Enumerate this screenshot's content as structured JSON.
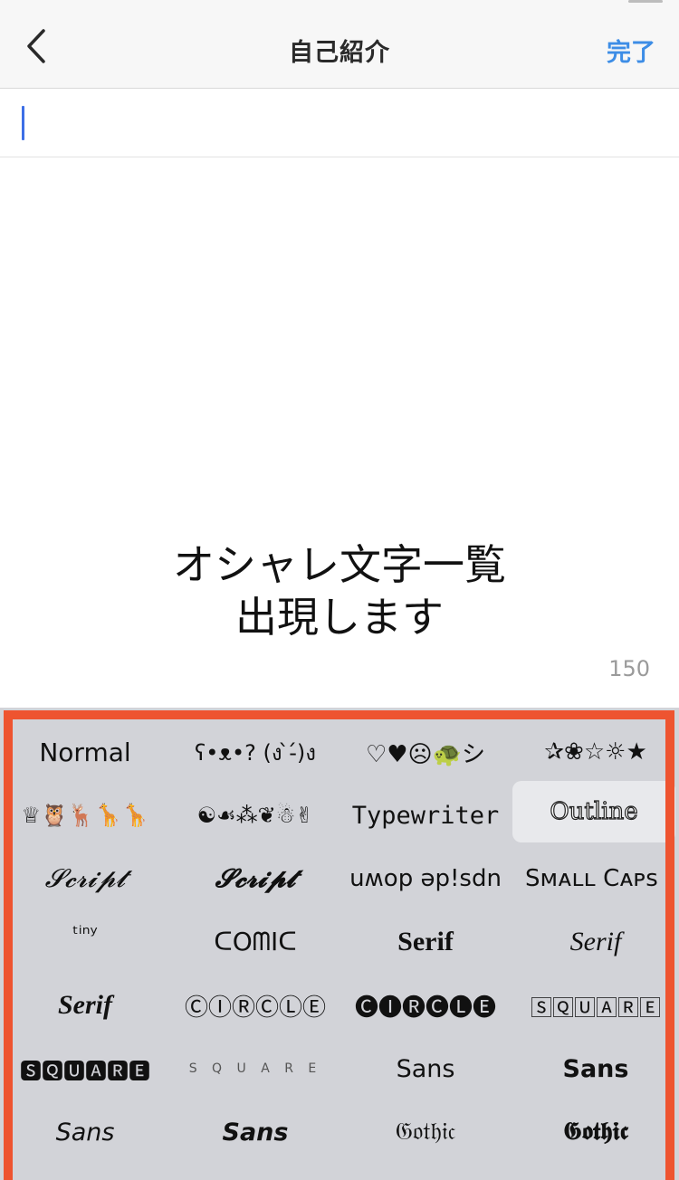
{
  "nav": {
    "title": "自己紹介",
    "done_label": "完了"
  },
  "promo": {
    "line1": "オシャレ文字一覧",
    "line2": "出現します"
  },
  "counter": "150",
  "font_styles": [
    "Normal",
    "ʕ•ᴥ•? (ง ̀-́)ง",
    "♡♥☹🐢シ",
    "✰❀☆☼★",
    "♕🦉🦌🦒🦒",
    "☯☙⁂❦☃✌",
    "Typewriter",
    "Outline",
    "𝓢𝓬𝓻𝓲𝓹𝓽",
    "𝓢𝓬𝓻𝓲𝓹𝓽",
    "uʍop ǝp!sdn",
    "Sᴍᴀʟʟ Cᴀᴘs",
    "ᵗⁱⁿʸ",
    "ᑕOᗰIᑕ",
    "Serif",
    "Serif",
    "Serif",
    "ⒸⒾⓇⒸⓁⒺ",
    "🅒🅘🅡🅒🅛🅔",
    "🅂🅀🅄🄰🅁🄴",
    "🆂🆀🆄🅰🆁🅴",
    "S Q U A R E",
    "Sans",
    "Sans",
    "Sans",
    "Sans",
    "𝔊𝔬𝔱𝔥𝔦𝔠",
    "𝕲𝖔𝖙𝖍𝖎𝖈"
  ]
}
